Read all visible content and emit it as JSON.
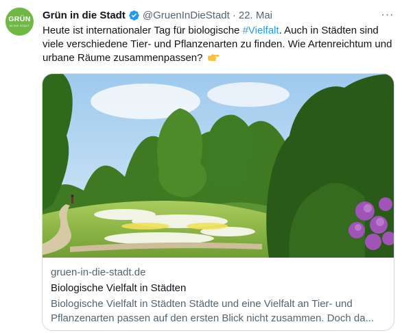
{
  "author": {
    "avatar_line1": "GRÜN",
    "avatar_line2": "IN DIE STADT",
    "display_name": "Grün in die Stadt",
    "handle": "@GruenInDieStadt",
    "separator": "·",
    "date": "22. Mai",
    "verified_icon": "verified-badge-icon"
  },
  "menu": {
    "more_icon": "more-dots-icon",
    "label": "···"
  },
  "tweet": {
    "text_before": "Heute ist internationaler Tag für biologische ",
    "hashtag": "#Vielfalt",
    "text_after": ". Auch in Städten sind viele verschiedene Tier- und Pflanzenarten zu finden. Wie Artenreichtum und urbane Räume zusammenpassen?",
    "emoji": "pointing-right-hand-emoji"
  },
  "link_card": {
    "image": "park-meadow-photo",
    "domain": "gruen-in-die-stadt.de",
    "title": "Biologische Vielfalt in Städten",
    "description": "Biologische Vielfalt in Städten Städte und eine Vielfalt an Tier- und Pflanzenarten passen auf den ersten Blick nicht zusammen. Doch da..."
  },
  "colors": {
    "brand_green": "#6eb843",
    "link_blue": "#1d9bf0",
    "muted": "#536471",
    "border": "#cfd9de"
  }
}
